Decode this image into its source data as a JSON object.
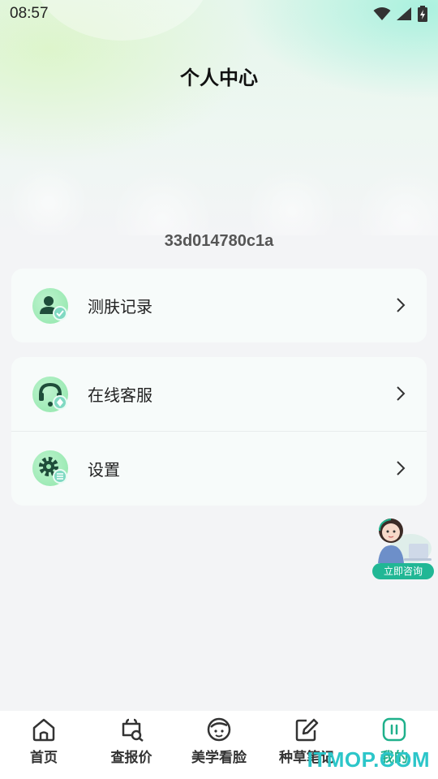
{
  "status": {
    "time": "08:57",
    "wifi_icon": "wifi-icon",
    "signal_icon": "signal-icon",
    "battery_icon": "battery-charging-icon"
  },
  "header": {
    "title": "个人中心"
  },
  "user": {
    "id": "33d014780c1a"
  },
  "menu_groups": [
    {
      "items": [
        {
          "label": "测肤记录",
          "icon": "skin-record-icon"
        }
      ]
    },
    {
      "items": [
        {
          "label": "在线客服",
          "icon": "customer-service-icon"
        },
        {
          "label": "设置",
          "icon": "settings-icon"
        }
      ]
    }
  ],
  "floating": {
    "consult_label": "立即咨询",
    "avatar_icon": "consultant-avatar-icon"
  },
  "tabbar": {
    "items": [
      {
        "label": "首页",
        "icon": "home-icon"
      },
      {
        "label": "查报价",
        "icon": "price-check-icon"
      },
      {
        "label": "美学看脸",
        "icon": "face-icon"
      },
      {
        "label": "种草笔记",
        "icon": "note-edit-icon"
      },
      {
        "label": "我的",
        "icon": "profile-icon",
        "active": true
      }
    ]
  },
  "watermark": "ITMOP.COM",
  "colors": {
    "accent": "#1fb08b",
    "icon_bg": "#9be9b3",
    "background": "#f3f4f6"
  }
}
